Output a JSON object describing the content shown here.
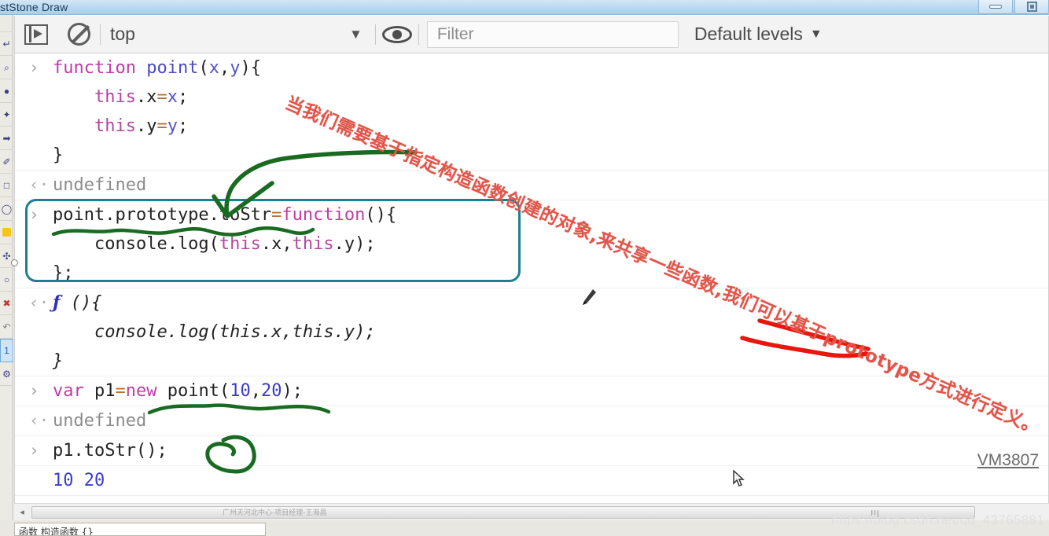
{
  "window": {
    "title": "stStone Draw",
    "buttons": [
      {
        "name": "minimize",
        "label": "–"
      },
      {
        "name": "restore",
        "label": "❐"
      }
    ]
  },
  "left_rail": {
    "tools": [
      {
        "name": "select-tool",
        "glyph": "↵"
      },
      {
        "name": "magnifier-tool",
        "glyph": "⌕"
      },
      {
        "name": "brush-tool",
        "glyph": "●"
      },
      {
        "name": "star-tool",
        "glyph": "✦"
      },
      {
        "name": "arrow-tool",
        "glyph": "➡"
      },
      {
        "name": "pen-tool",
        "glyph": "✐"
      },
      {
        "name": "rectangle-tool",
        "glyph": "□"
      },
      {
        "name": "ellipse-tool",
        "glyph": "◯"
      },
      {
        "name": "highlight-tool",
        "glyph": ""
      },
      {
        "name": "move-tool",
        "glyph": "✣"
      },
      {
        "name": "circle-tool",
        "glyph": "○"
      },
      {
        "name": "delete-tool",
        "glyph": "✖"
      },
      {
        "name": "undo-tool",
        "glyph": "↶"
      },
      {
        "name": "page-tool",
        "glyph": "1"
      },
      {
        "name": "settings-tool",
        "glyph": "⚙"
      }
    ]
  },
  "toolbar": {
    "execution_context_icon": "execution-context-icon",
    "clear_console_icon": "clear-console-icon",
    "eye_icon": "eye-icon",
    "context_value": "top",
    "context_caret": "▼",
    "filter": {
      "placeholder": "Filter",
      "value": ""
    },
    "levels_label": "Default levels",
    "levels_caret": "▼"
  },
  "console": {
    "prompt_marker": "›",
    "output_marker": "‹·",
    "entries": [
      {
        "type": "input",
        "lines": [
          [
            {
              "t": "function ",
              "c": "kw"
            },
            {
              "t": "point",
              "c": "fn"
            },
            {
              "t": "(",
              "c": "plain"
            },
            {
              "t": "x",
              "c": "prm"
            },
            {
              "t": ",",
              "c": "plain"
            },
            {
              "t": "y",
              "c": "prm"
            },
            {
              "t": "){",
              "c": "plain"
            }
          ],
          [
            {
              "t": "    ",
              "c": "plain"
            },
            {
              "t": "this",
              "c": "prop"
            },
            {
              "t": ".x",
              "c": "plain"
            },
            {
              "t": "=",
              "c": "op"
            },
            {
              "t": "x",
              "c": "prm"
            },
            {
              "t": ";",
              "c": "plain"
            }
          ],
          [
            {
              "t": "    ",
              "c": "plain"
            },
            {
              "t": "this",
              "c": "prop"
            },
            {
              "t": ".y",
              "c": "plain"
            },
            {
              "t": "=",
              "c": "op"
            },
            {
              "t": "y",
              "c": "prm"
            },
            {
              "t": ";",
              "c": "plain"
            }
          ],
          [
            {
              "t": "}",
              "c": "plain"
            }
          ]
        ]
      },
      {
        "type": "output",
        "lines": [
          [
            {
              "t": "undefined",
              "c": "undef"
            }
          ]
        ]
      },
      {
        "type": "input",
        "highlighted": true,
        "lines": [
          [
            {
              "t": "point.prototype.toStr",
              "c": "plain"
            },
            {
              "t": "=",
              "c": "op"
            },
            {
              "t": "function",
              "c": "kw"
            },
            {
              "t": "(){",
              "c": "plain"
            }
          ],
          [
            {
              "t": "    console.log(",
              "c": "plain"
            },
            {
              "t": "this",
              "c": "prop"
            },
            {
              "t": ".x,",
              "c": "plain"
            },
            {
              "t": "this",
              "c": "prop"
            },
            {
              "t": ".y);",
              "c": "plain"
            }
          ],
          [
            {
              "t": "};",
              "c": "plain"
            }
          ]
        ]
      },
      {
        "type": "output",
        "italic": true,
        "lines": [
          [
            {
              "t": "ƒ",
              "c": "ff"
            },
            {
              "t": " (){",
              "c": "plain"
            }
          ],
          [
            {
              "t": "    console.log(this.x,this.y);",
              "c": "plain"
            }
          ],
          [
            {
              "t": "}",
              "c": "plain"
            }
          ]
        ]
      },
      {
        "type": "input",
        "lines": [
          [
            {
              "t": "var ",
              "c": "kw"
            },
            {
              "t": "p1",
              "c": "plain"
            },
            {
              "t": "=",
              "c": "op"
            },
            {
              "t": "new",
              "c": "kw"
            },
            {
              "t": " point(",
              "c": "plain"
            },
            {
              "t": "10",
              "c": "num"
            },
            {
              "t": ",",
              "c": "plain"
            },
            {
              "t": "20",
              "c": "num"
            },
            {
              "t": ");",
              "c": "plain"
            }
          ]
        ]
      },
      {
        "type": "output",
        "lines": [
          [
            {
              "t": "undefined",
              "c": "undef"
            }
          ]
        ]
      },
      {
        "type": "input",
        "lines": [
          [
            {
              "t": "p1.toStr();",
              "c": "plain"
            }
          ]
        ]
      },
      {
        "type": "log",
        "source": "VM3807",
        "lines": [
          [
            {
              "t": "10 20",
              "c": "num"
            }
          ]
        ]
      }
    ],
    "vm_source_label": "VM3807"
  },
  "annotation": {
    "handwritten_note": "当我们需要基于指定构造函数创建的对象,来共享一些函数,我们可以基于prototype方式进行定义。",
    "note_color": "#e2554a",
    "box_color": "#1d7f92",
    "green_ink_color": "#1a6b22",
    "red_ink_color": "#e8170d"
  },
  "statusbar": {
    "scroll_left_arrow": "◂",
    "scroll_grip": "⫿ff",
    "bottom_cut_text": "函数 构造函数 {}",
    "watermark_center": "广州天河北中心-项目经理-王海昌",
    "watermark_right": "https://blog.csdn.net/qq_43765881"
  }
}
